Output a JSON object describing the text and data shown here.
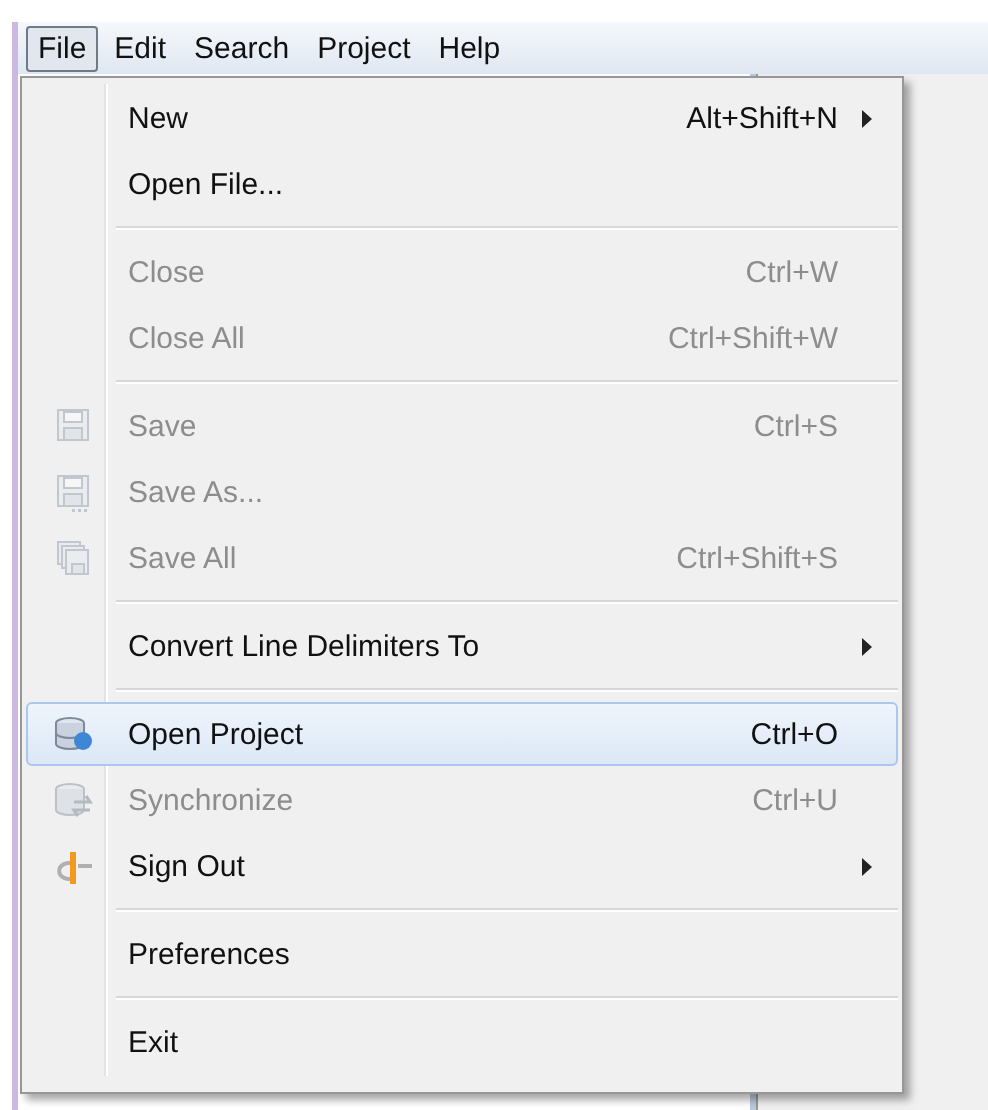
{
  "menubar": [
    {
      "label": "File",
      "selected": true
    },
    {
      "label": "Edit",
      "selected": false
    },
    {
      "label": "Search",
      "selected": false
    },
    {
      "label": "Project",
      "selected": false
    },
    {
      "label": "Help",
      "selected": false
    }
  ],
  "file_menu": {
    "groups": [
      [
        {
          "label": "New",
          "shortcut": "Alt+Shift+N",
          "submenu": true,
          "disabled": false,
          "selected": false
        },
        {
          "label": "Open File...",
          "disabled": false,
          "selected": false
        }
      ],
      [
        {
          "label": "Close",
          "shortcut": "Ctrl+W",
          "disabled": true,
          "selected": false
        },
        {
          "label": "Close All",
          "shortcut": "Ctrl+Shift+W",
          "disabled": true,
          "selected": false
        }
      ],
      [
        {
          "label": "Save",
          "shortcut": "Ctrl+S",
          "disabled": true,
          "selected": false
        },
        {
          "label": "Save As...",
          "disabled": true,
          "selected": false
        },
        {
          "label": "Save All",
          "shortcut": "Ctrl+Shift+S",
          "disabled": true,
          "selected": false
        }
      ],
      [
        {
          "label": "Convert Line Delimiters To",
          "submenu": true,
          "disabled": false,
          "selected": false
        }
      ],
      [
        {
          "label": "Open Project",
          "shortcut": "Ctrl+O",
          "disabled": false,
          "selected": true
        },
        {
          "label": "Synchronize",
          "shortcut": "Ctrl+U",
          "disabled": true,
          "selected": false
        },
        {
          "label": "Sign Out",
          "submenu": true,
          "disabled": false,
          "selected": false
        }
      ],
      [
        {
          "label": "Preferences",
          "disabled": false,
          "selected": false
        }
      ],
      [
        {
          "label": "Exit",
          "disabled": false,
          "selected": false
        }
      ]
    ]
  }
}
